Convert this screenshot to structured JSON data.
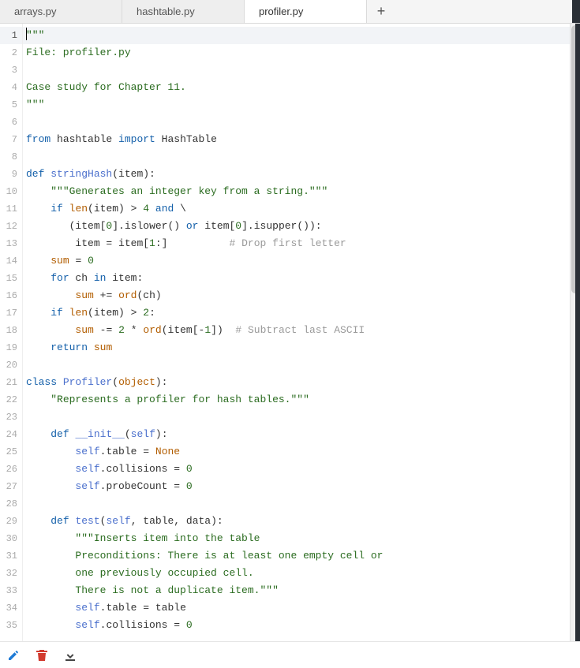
{
  "tabs": [
    {
      "label": "arrays.py",
      "active": false
    },
    {
      "label": "hashtable.py",
      "active": false
    },
    {
      "label": "profiler.py",
      "active": true
    }
  ],
  "newtab_glyph": "+",
  "gutter_start": 1,
  "gutter_end": 35,
  "active_line": 1,
  "code": {
    "l1": {
      "a": "\"\"\""
    },
    "l2": {
      "a": "File: profiler.py"
    },
    "l3": {
      "a": ""
    },
    "l4": {
      "a": "Case study for Chapter 11."
    },
    "l5": {
      "a": "\"\"\""
    },
    "l6": {
      "a": ""
    },
    "l7": {
      "a": "from",
      "b": " hashtable ",
      "c": "import",
      "d": " HashTable"
    },
    "l8": {
      "a": ""
    },
    "l9": {
      "a": "def",
      "b": " ",
      "c": "stringHash",
      "d": "(item):"
    },
    "l10": {
      "a": "    ",
      "b": "\"\"\"Generates an integer key from a string.\"\"\""
    },
    "l11": {
      "a": "    ",
      "b": "if",
      "c": " ",
      "d": "len",
      "e": "(item) ",
      "f": ">",
      "g": " ",
      "h": "4",
      "i": " ",
      "j": "and",
      "k": " \\"
    },
    "l12": {
      "a": "       (item[",
      "b": "0",
      "c": "]",
      "d": ".",
      "e": "islower() ",
      "f": "or",
      "g": " item[",
      "h": "0",
      "i": "]",
      "j": ".",
      "k": "isupper()):"
    },
    "l13": {
      "a": "        item ",
      "b": "=",
      "c": " item[",
      "d": "1",
      "e": ":]",
      "pad": "          ",
      "f": "# Drop first letter"
    },
    "l14": {
      "a": "    ",
      "b": "sum",
      "c": " ",
      "d": "=",
      "e": " ",
      "f": "0"
    },
    "l15": {
      "a": "    ",
      "b": "for",
      "c": " ch ",
      "d": "in",
      "e": " item:"
    },
    "l16": {
      "a": "        ",
      "b": "sum",
      "c": " ",
      "d": "+=",
      "e": " ",
      "f": "ord",
      "g": "(ch)"
    },
    "l17": {
      "a": "    ",
      "b": "if",
      "c": " ",
      "d": "len",
      "e": "(item) ",
      "f": ">",
      "g": " ",
      "h": "2",
      "i": ":"
    },
    "l18": {
      "a": "        ",
      "b": "sum",
      "c": " ",
      "d": "-=",
      "e": " ",
      "f": "2",
      "g": " ",
      "h": "*",
      "i": " ",
      "j": "ord",
      "k": "(item[",
      "l": "-",
      "m": "1",
      "n": "])  ",
      "o": "# Subtract last ASCII"
    },
    "l19": {
      "a": "    ",
      "b": "return",
      "c": " ",
      "d": "sum"
    },
    "l20": {
      "a": ""
    },
    "l21": {
      "a": "class",
      "b": " ",
      "c": "Profiler",
      "d": "(",
      "e": "object",
      "f": "):"
    },
    "l22": {
      "a": "    ",
      "b": "\"Represents a profiler for hash tables.\"\"\""
    },
    "l23": {
      "a": ""
    },
    "l24": {
      "a": "    ",
      "b": "def",
      "c": " ",
      "d": "__init__",
      "e": "(",
      "f": "self",
      "g": "):"
    },
    "l25": {
      "a": "        ",
      "b": "self",
      "c": ".",
      "d": "table ",
      "e": "=",
      "f": " ",
      "g": "None"
    },
    "l26": {
      "a": "        ",
      "b": "self",
      "c": ".",
      "d": "collisions ",
      "e": "=",
      "f": " ",
      "g": "0"
    },
    "l27": {
      "a": "        ",
      "b": "self",
      "c": ".",
      "d": "probeCount ",
      "e": "=",
      "f": " ",
      "g": "0"
    },
    "l28": {
      "a": ""
    },
    "l29": {
      "a": "    ",
      "b": "def",
      "c": " ",
      "d": "test",
      "e": "(",
      "f": "self",
      "g": ", table, data):"
    },
    "l30": {
      "a": "        ",
      "b": "\"\"\"Inserts item into the table"
    },
    "l31": {
      "a": "        ",
      "b": "Preconditions: There is at least one empty cell or"
    },
    "l32": {
      "a": "        ",
      "b": "one previously occupied cell."
    },
    "l33": {
      "a": "        ",
      "b": "There is not a duplicate item.\"\"\""
    },
    "l34": {
      "a": "        ",
      "b": "self",
      "c": ".",
      "d": "table ",
      "e": "=",
      "f": " table"
    },
    "l35": {
      "a": "        ",
      "b": "self",
      "c": ".",
      "d": "collisions ",
      "e": "=",
      "f": " ",
      "g": "0"
    }
  },
  "toolbar": {
    "edit": "edit",
    "delete": "delete",
    "download": "download"
  }
}
